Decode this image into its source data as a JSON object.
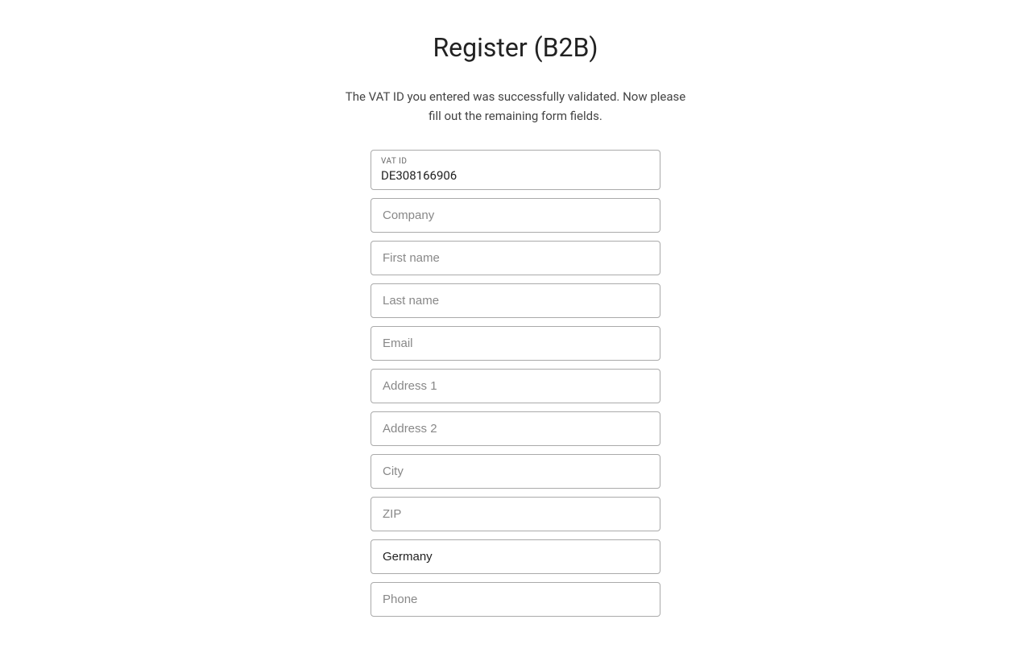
{
  "page": {
    "title": "Register (B2B)",
    "subtitle_line1": "The VAT ID you entered was successfully validated. Now please",
    "subtitle_line2": "fill out the remaining form fields."
  },
  "vat_field": {
    "label": "VAT ID",
    "value": "DE308166906"
  },
  "fields": [
    {
      "id": "company",
      "placeholder": "Company",
      "type": "text",
      "value": ""
    },
    {
      "id": "first-name",
      "placeholder": "First name",
      "type": "text",
      "value": ""
    },
    {
      "id": "last-name",
      "placeholder": "Last name",
      "type": "text",
      "value": ""
    },
    {
      "id": "email",
      "placeholder": "Email",
      "type": "email",
      "value": ""
    },
    {
      "id": "address1",
      "placeholder": "Address 1",
      "type": "text",
      "value": ""
    },
    {
      "id": "address2",
      "placeholder": "Address 2",
      "type": "text",
      "value": ""
    },
    {
      "id": "city",
      "placeholder": "City",
      "type": "text",
      "value": ""
    },
    {
      "id": "zip",
      "placeholder": "ZIP",
      "type": "text",
      "value": ""
    },
    {
      "id": "country",
      "placeholder": "Germany",
      "type": "text",
      "value": "Germany",
      "is_country": true
    },
    {
      "id": "phone",
      "placeholder": "Phone",
      "type": "tel",
      "value": ""
    }
  ]
}
